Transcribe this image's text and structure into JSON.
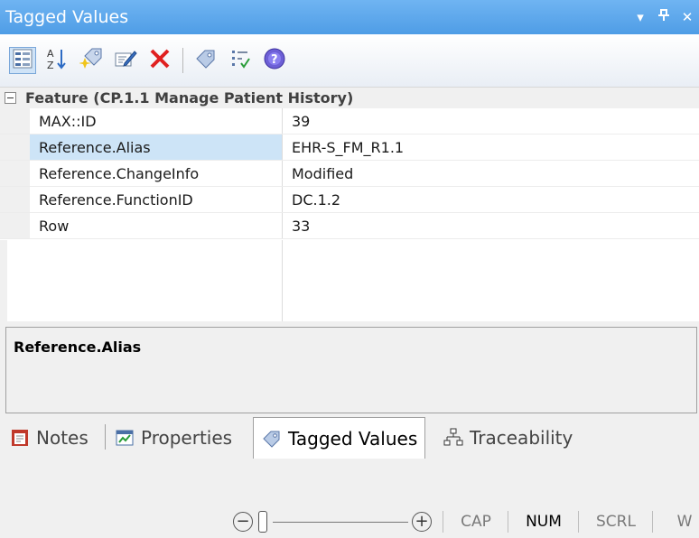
{
  "window": {
    "title": "Tagged Values",
    "dropdown_glyph": "▾",
    "pin_glyph": "ᵖ",
    "close_glyph": "✕"
  },
  "toolbar": {
    "buttons": [
      {
        "icon": "categorized-view-icon"
      },
      {
        "icon": "sort-alphabetical-icon"
      },
      {
        "icon": "new-tag-icon"
      },
      {
        "icon": "edit-tag-icon"
      },
      {
        "icon": "delete-icon"
      },
      {
        "icon": "tag-icon"
      },
      {
        "icon": "checklist-icon"
      },
      {
        "icon": "help-icon"
      }
    ]
  },
  "grid": {
    "category": "Feature (CP.1.1 Manage Patient History)",
    "rows": [
      {
        "name": "MAX::ID",
        "value": "39"
      },
      {
        "name": "Reference.Alias",
        "value": "EHR-S_FM_R1.1"
      },
      {
        "name": "Reference.ChangeInfo",
        "value": "Modified"
      },
      {
        "name": "Reference.FunctionID",
        "value": "DC.1.2"
      },
      {
        "name": "Row",
        "value": "33"
      }
    ],
    "selected_index": 1
  },
  "description": {
    "title": "Reference.Alias"
  },
  "tabs": [
    {
      "label": "Notes",
      "icon": "notes-icon"
    },
    {
      "label": "Properties",
      "icon": "properties-icon"
    },
    {
      "label": "Tagged Values",
      "icon": "tag-icon",
      "active": true
    },
    {
      "label": "Traceability",
      "icon": "traceability-icon"
    }
  ],
  "statusbar": {
    "zoom_minus": "−",
    "zoom_plus": "+",
    "indicators": [
      {
        "label": "CAP",
        "active": false
      },
      {
        "label": "NUM",
        "active": true
      },
      {
        "label": "SCRL",
        "active": false
      },
      {
        "label": "W",
        "active": false
      }
    ]
  },
  "colors": {
    "titlebar": "#5aa6ec",
    "selection": "#cde4f7"
  }
}
